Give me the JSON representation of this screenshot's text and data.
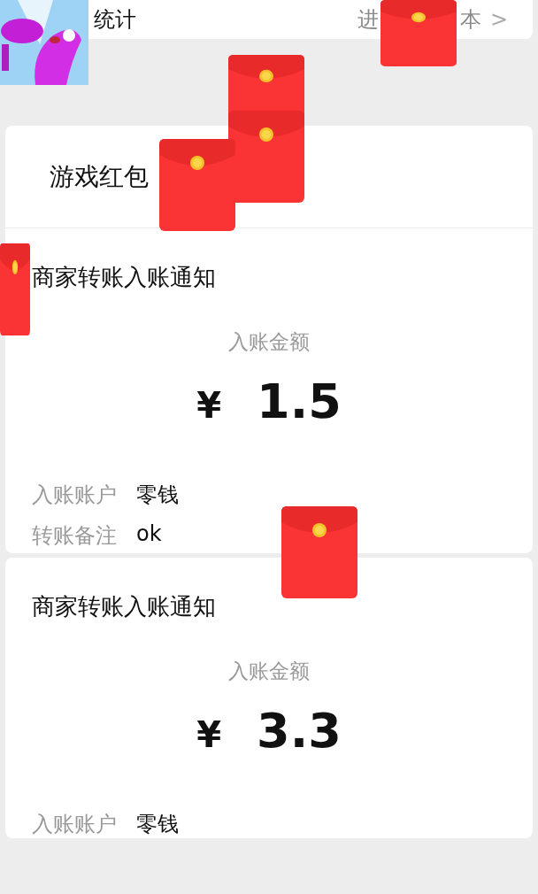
{
  "top_row": {
    "title": "统计",
    "link_left": "进",
    "link_right": "本",
    "chevron": ">"
  },
  "game_row": {
    "title": "游戏红包"
  },
  "notifications": [
    {
      "title": "商家转账入账通知",
      "amount_label": "入账金额",
      "currency": "¥",
      "amount": "1.5",
      "fields": [
        {
          "label": "入账账户",
          "value": "零钱"
        },
        {
          "label": "转账备注",
          "value": "ok"
        }
      ]
    },
    {
      "title": "商家转账入账通知",
      "amount_label": "入账金额",
      "currency": "¥",
      "amount": "3.3",
      "fields": [
        {
          "label": "入账账户",
          "value": "零钱"
        }
      ]
    }
  ]
}
